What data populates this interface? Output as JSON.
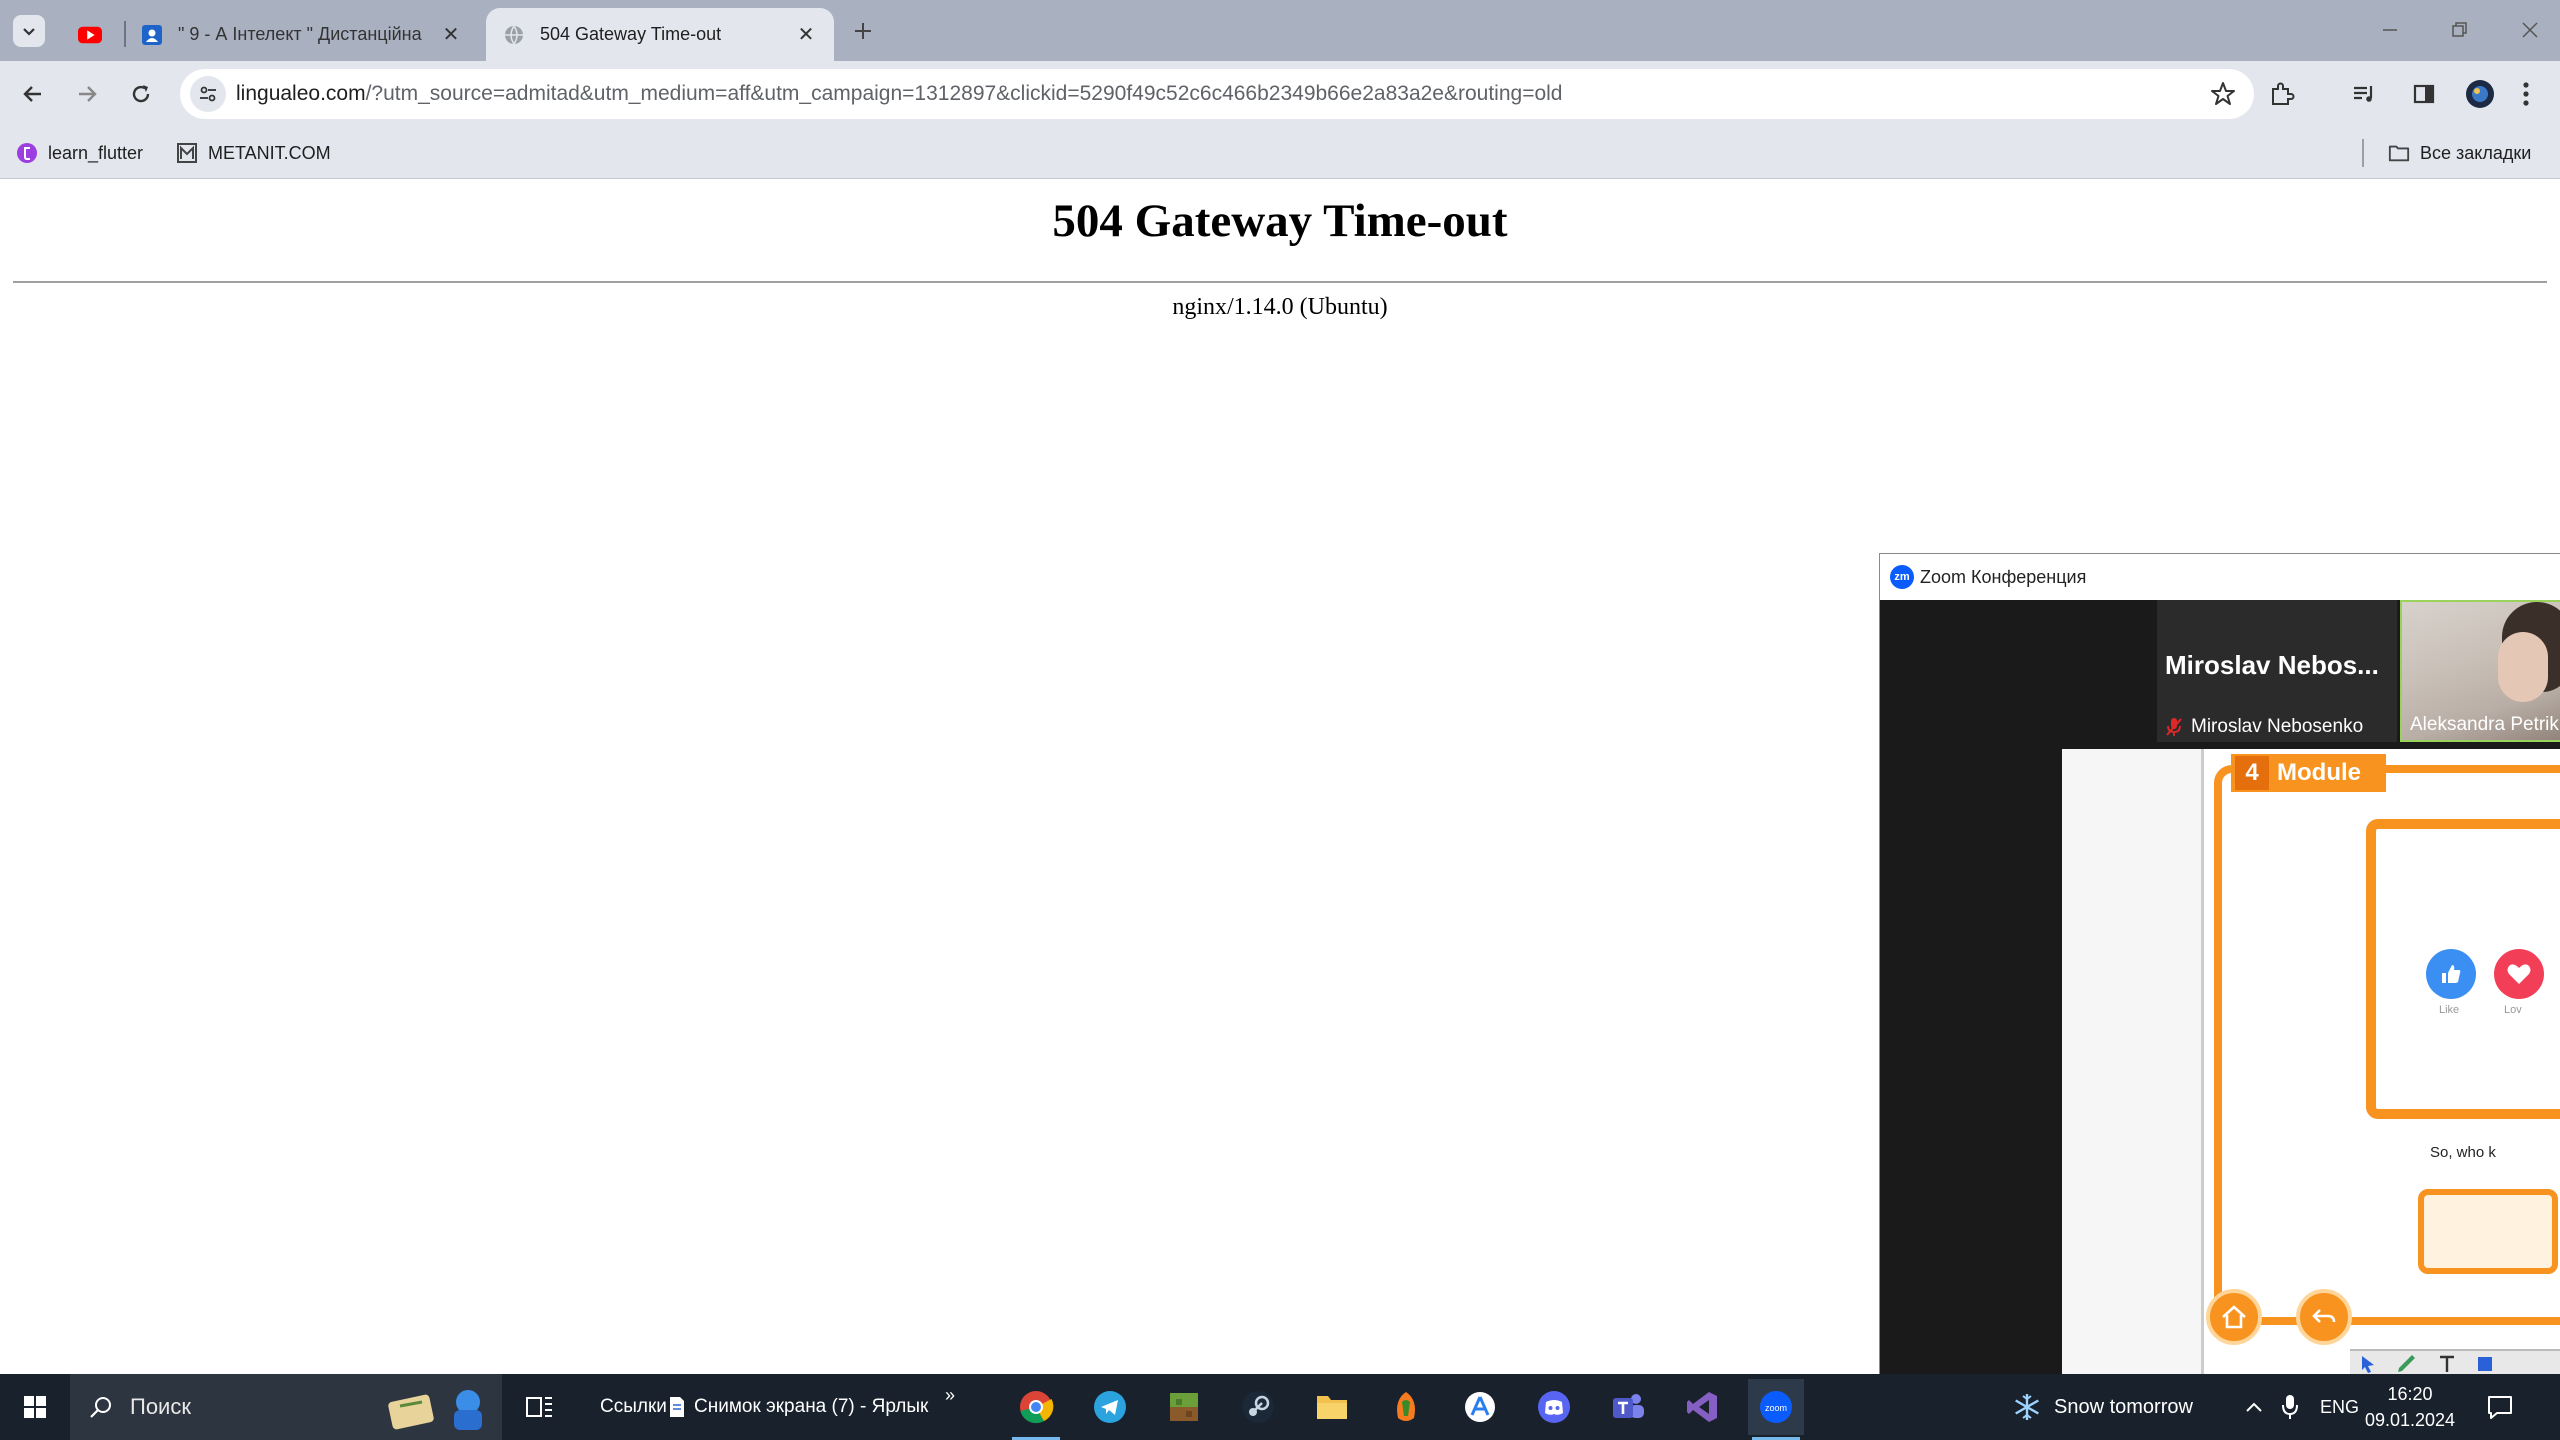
{
  "browser": {
    "tabs": [
      {
        "title": "",
        "favicon": "youtube-icon"
      },
      {
        "title": "\" 9 - А Інтелект \" Дистанційна",
        "favicon": "classroom-icon"
      },
      {
        "title": "504 Gateway Time-out",
        "favicon": "globe-icon",
        "active": true
      }
    ],
    "url_host": "lingualeo.com",
    "url_path": "/?utm_source=admitad&utm_medium=aff&utm_campaign=1312897&clickid=5290f49c52c6c466b2349b66e2a83a2e&routing=old",
    "bookmarks": [
      {
        "label": "learn_flutter",
        "icon": "flutter-bookmark-icon"
      },
      {
        "label": "METANIT.COM",
        "icon": "metanit-bookmark-icon"
      }
    ],
    "all_bookmarks_label": "Все закладки"
  },
  "page": {
    "heading": "504 Gateway Time-out",
    "server": "nginx/1.14.0 (Ubuntu)"
  },
  "zoom": {
    "window_title": "Zoom Конференция",
    "logo_text": "zm",
    "participants": [
      {
        "name_large": "Miroslav  Nebos...",
        "name": "Miroslav Nebosenko",
        "muted": true
      },
      {
        "name": "Aleksandra Petrik",
        "video": true
      }
    ],
    "slide": {
      "module_number": "4",
      "module_label": "Module",
      "like_label": "Like",
      "love_label": "Lov",
      "caption": "So, who k"
    }
  },
  "taskbar": {
    "search_label": "Поиск",
    "links_label": "Ссылки",
    "pinned_shortcut": "Снимок экрана (7) - Ярлык",
    "overflow": "»",
    "weather": "Snow tomorrow",
    "language": "ENG",
    "time": "16:20",
    "date": "09.01.2024"
  },
  "colors": {
    "tabstrip": "#a9b0c0",
    "toolbar": "#e3e6ed",
    "taskbar": "#18212c",
    "slide_accent": "#f7931e"
  }
}
